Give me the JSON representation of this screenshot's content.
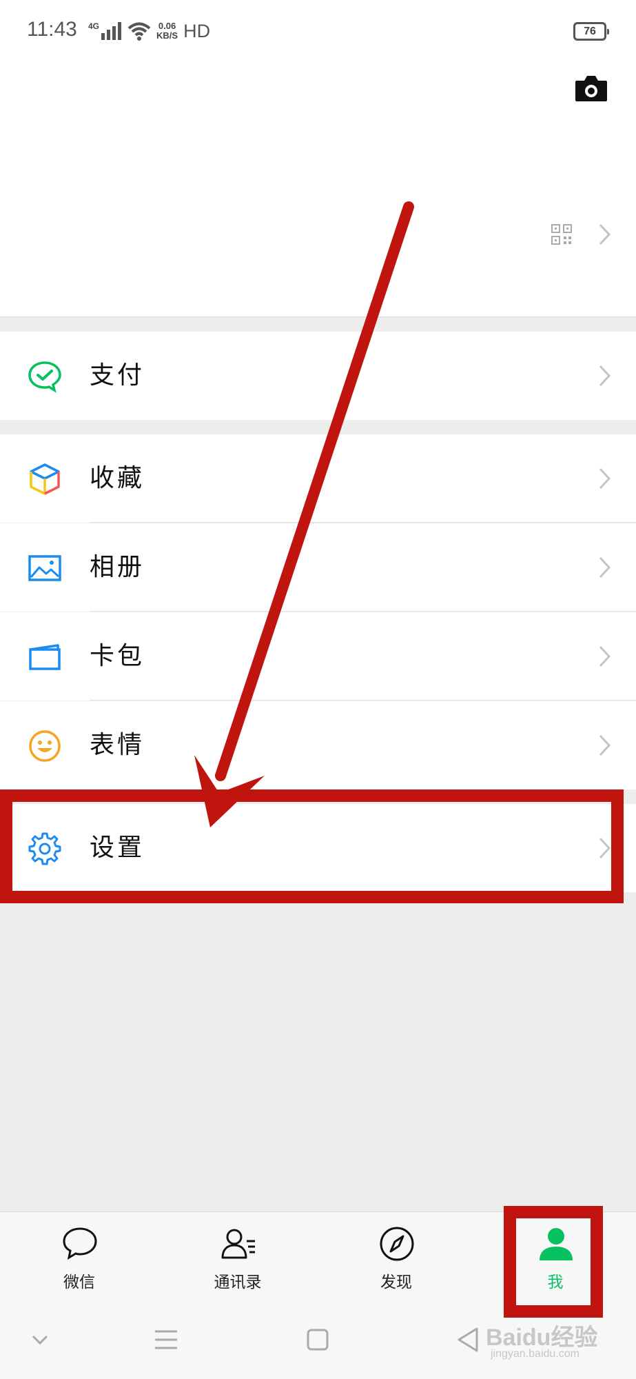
{
  "status_bar": {
    "time": "11:43",
    "network": "4G",
    "speed_value": "0.06",
    "speed_unit": "KB/S",
    "hd": "HD",
    "battery": "76"
  },
  "header": {
    "camera_icon": "camera-icon",
    "qr_icon": "qr-code-icon"
  },
  "menu": {
    "pay": {
      "label": "支付",
      "icon": "wechat-pay-icon",
      "color": "#07c160"
    },
    "favorites": {
      "label": "收藏",
      "icon": "cube-icon"
    },
    "album": {
      "label": "相册",
      "icon": "album-icon",
      "color": "#1a8cf0"
    },
    "cards": {
      "label": "卡包",
      "icon": "card-wallet-icon",
      "color": "#1a8cf0"
    },
    "stickers": {
      "label": "表情",
      "icon": "smiley-icon",
      "color": "#f5a623"
    },
    "settings": {
      "label": "设置",
      "icon": "gear-icon",
      "color": "#1a8cf0"
    }
  },
  "tabs": [
    {
      "label": "微信",
      "icon": "chat-bubble-icon",
      "active": false
    },
    {
      "label": "通讯录",
      "icon": "contacts-icon",
      "active": false
    },
    {
      "label": "发现",
      "icon": "compass-icon",
      "active": false
    },
    {
      "label": "我",
      "icon": "person-icon",
      "active": true
    }
  ],
  "accent_color": "#07c160",
  "annotation_color": "#c0150f",
  "watermark": {
    "brand": "Baidu经验",
    "url": "jingyan.baidu.com"
  }
}
